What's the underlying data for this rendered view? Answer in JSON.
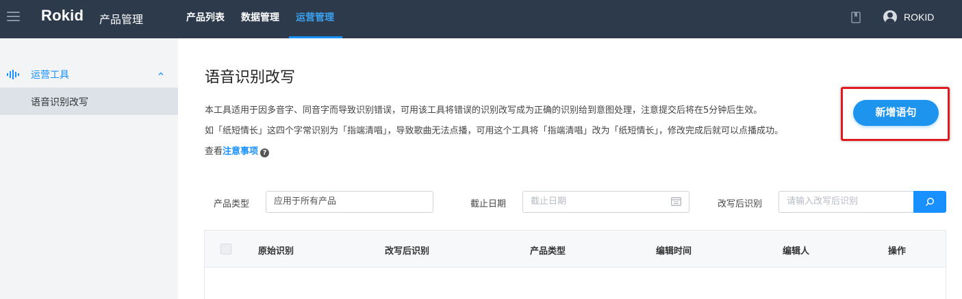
{
  "header": {
    "logo": "Rokid",
    "product_title": "产品管理",
    "nav": [
      {
        "label": "产品列表",
        "active": false
      },
      {
        "label": "数据管理",
        "active": false
      },
      {
        "label": "运营管理",
        "active": true
      }
    ],
    "username": "ROKID",
    "icons": [
      "menu-icon",
      "document-icon",
      "user-avatar-icon"
    ]
  },
  "sidebar": {
    "group": {
      "label": "运营工具",
      "icon": "sound-wave-icon",
      "expanded": true
    },
    "items": [
      {
        "label": "语音识别改写",
        "active": true
      }
    ]
  },
  "main": {
    "title": "语音识别改写",
    "description": [
      "本工具适用于因多音字、同音字而导致识别错误，可用该工具将错误的识别改写成为正确的识别给到意图处理，注意提交后将在5分钟后生效。",
      "如「纸短情长」这四个字常识别为「指端清唱」，导致歌曲无法点播，可用这个工具将「指端清唱」改为「纸短情长」，修改完成后就可以点播成功。"
    ],
    "notice_prefix": "查看",
    "notice_link": "注意事项",
    "help_glyph": "?",
    "add_button": "新增语句"
  },
  "filters": {
    "product_type": {
      "label": "产品类型",
      "value": "应用于所有产品"
    },
    "deadline": {
      "label": "截止日期",
      "placeholder": "截止日期"
    },
    "rewritten": {
      "label": "改写后识别",
      "placeholder": "请输入改写后识别"
    }
  },
  "table": {
    "columns": [
      "原始识别",
      "改写后识别",
      "产品类型",
      "编辑时间",
      "编辑人",
      "操作"
    ],
    "rows": []
  },
  "colors": {
    "topbar": "#2d3a4b",
    "accent": "#1890ff",
    "button": "#1d95ef",
    "highlight": "#e0191f",
    "sidebar": "#f3f4f6"
  }
}
